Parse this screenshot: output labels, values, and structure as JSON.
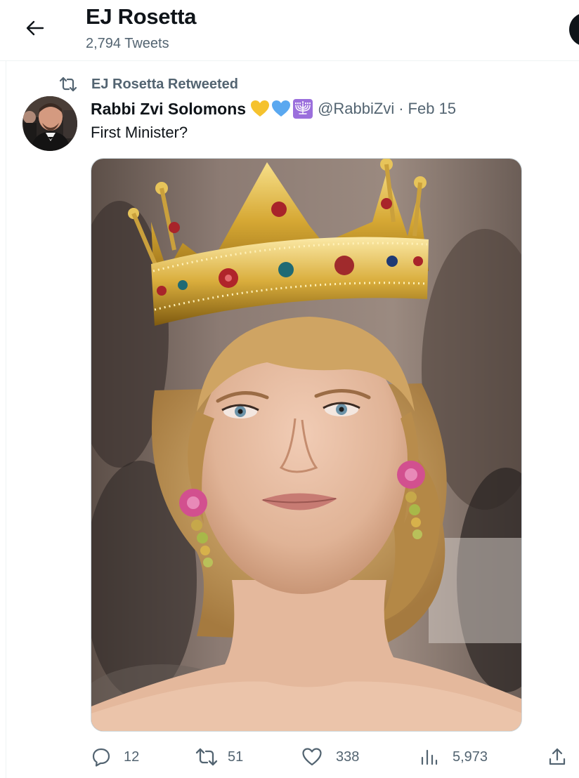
{
  "header": {
    "title": "EJ Rosetta",
    "subtitle": "2,794 Tweets",
    "back_icon": "arrow-left-icon"
  },
  "tweet": {
    "retweet_context": "EJ Rosetta Retweeted",
    "author_name": "Rabbi Zvi Solomons",
    "badges": [
      "yellow-heart-emoji",
      "blue-heart-emoji",
      "menorah-emoji"
    ],
    "handle": "@RabbiZvi",
    "separator": "·",
    "date": "Feb 15",
    "text": "First Minister?",
    "media": {
      "alt": "photo of a woman with blonde hair wearing a gold jeweled crown and pink flower earrings",
      "colors": {
        "crown_gold": "#d9ad3c",
        "hair": "#c9a064",
        "skin": "#e6bca2",
        "background": "#8a7468"
      }
    },
    "actions": {
      "replies": "12",
      "retweets": "51",
      "likes": "338",
      "views": "5,973"
    }
  },
  "colors": {
    "text_primary": "#0f1419",
    "text_secondary": "#536471",
    "border": "#eff3f4",
    "heart_yellow": "#f5c22e",
    "heart_blue": "#5aa8f0",
    "menorah_bg": "#9b6fdc"
  }
}
